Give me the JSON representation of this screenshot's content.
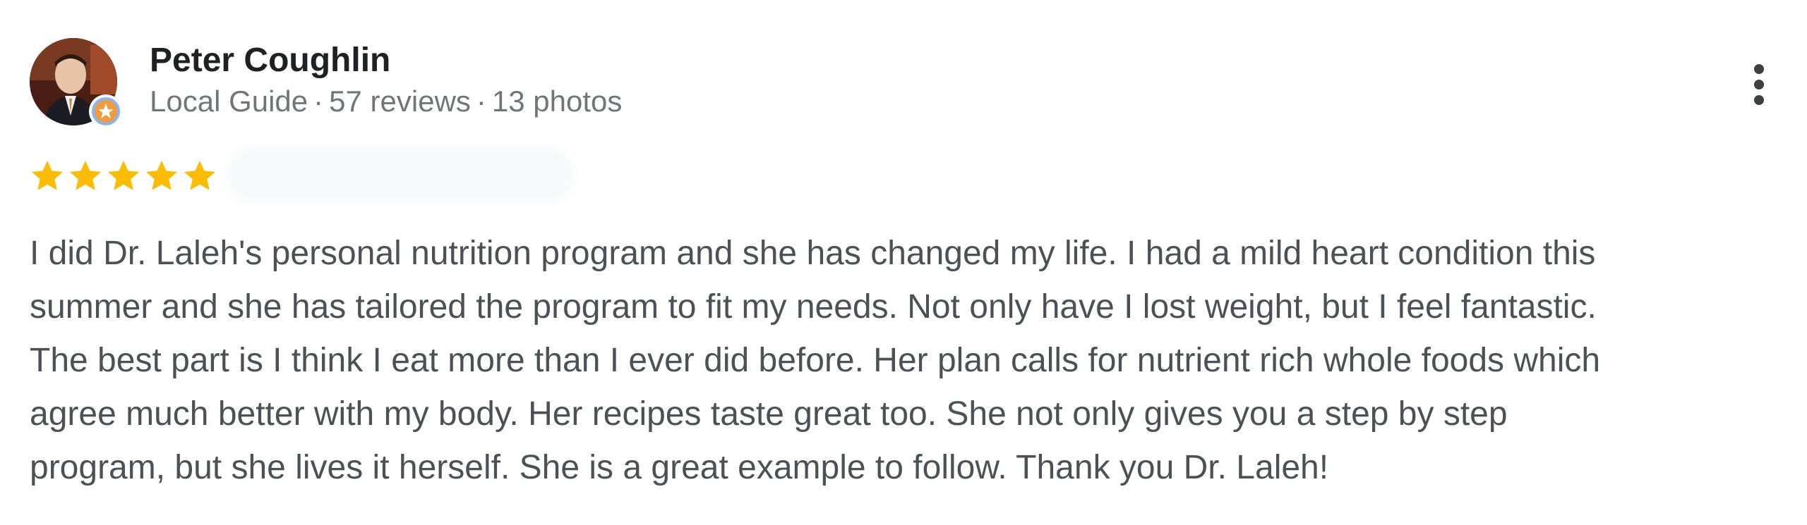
{
  "review": {
    "author": {
      "name": "Peter Coughlin",
      "badge": "Local Guide",
      "reviews": "57 reviews",
      "photos": "13 photos",
      "separator": "·"
    },
    "rating": {
      "stars": 5,
      "max": 5,
      "color": "#fbbc04"
    },
    "text_lines": [
      "I did Dr. Laleh's personal nutrition program and she has changed my life. I had a mild heart condition this",
      "summer and she has tailored the program to fit my needs. Not only have I lost weight, but I feel fantastic.",
      "The best part is I think I eat more than I ever did before. Her plan calls for nutrient rich whole foods which",
      "agree much better with my body. Her recipes taste great too. She not only gives you a step by step",
      "program, but she lives it herself. She is a great example to follow. Thank you Dr. Laleh!"
    ]
  },
  "icons": {
    "avatar": "profile-photo",
    "badge": "local-guide-star-icon",
    "menu": "more-vert-icon",
    "star": "star-icon"
  }
}
